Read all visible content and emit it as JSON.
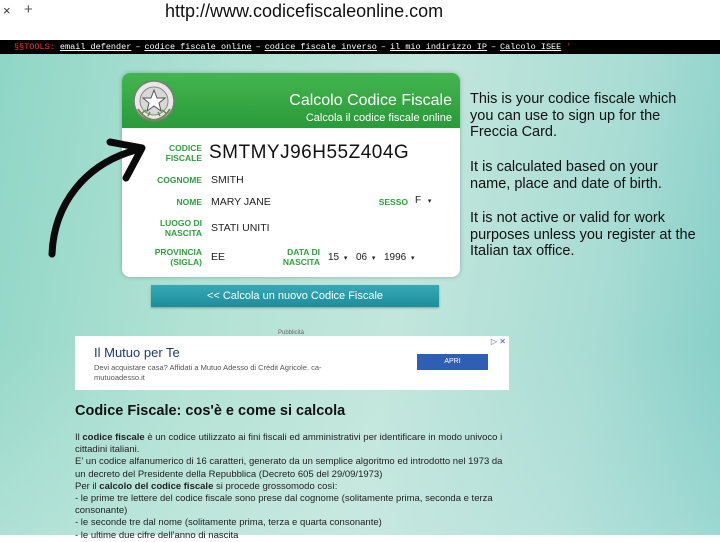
{
  "browser": {
    "close_glyph": "×",
    "new_tab_glyph": "+",
    "url": "http://www.codicefiscaleonline.com"
  },
  "toolbar": {
    "brand": "§§TOOLS:",
    "links": [
      "email defender",
      "codice fiscale online",
      "codice fiscale inverso",
      "il mio indirizzo IP",
      "Calcolo ISEE"
    ],
    "separator": "–",
    "end": "'"
  },
  "card": {
    "title": "Calcolo Codice Fiscale",
    "subtitle": "Calcola il codice fiscale online",
    "fields": {
      "codice_label": "CODICE FISCALE",
      "codice_value": "SMTMYJ96H55Z404G",
      "cognome_label": "COGNOME",
      "cognome_value": "SMITH",
      "nome_label": "NOME",
      "nome_value": "MARY JANE",
      "sesso_label": "SESSO",
      "sesso_value": "F",
      "luogo_label": "LUOGO DI NASCITA",
      "luogo_value": "STATI UNITI",
      "provincia_label": "PROVINCIA (SIGLA)",
      "provincia_value": "EE",
      "data_label": "DATA DI NASCITA",
      "day": "15",
      "month": "06",
      "year": "1996"
    },
    "dropdown_glyph": "▾"
  },
  "calc_button": "<< Calcola un nuovo Codice Fiscale",
  "caption": {
    "p1": "This is your codice fiscale which you can use to sign up for the Freccia Card.",
    "p2": "It is calculated based on your name, place and date of birth.",
    "p3": "It is not active or valid for work purposes unless you register at the Italian tax office."
  },
  "ad": {
    "label": "Pubblicità",
    "title": "Il Mutuo per Te",
    "text": "Devi acquistare casa? Affidati a Mutuo Adesso di Crédit Agricole. ca-mutuoadesso.it",
    "button": "APRI",
    "icons": "▷ ✕"
  },
  "article": {
    "title": "Codice Fiscale: cos'è e come si calcola",
    "p1_pre": "Il ",
    "p1_bold": "codice fiscale",
    "p1_post": " è un codice utilizzato ai fini fiscali ed amministrativi per identificare in modo univoco i cittadini italiani.",
    "p2": "E' un codice alfanumerico di 16 caratteri, generato da un semplice algoritmo ed introdotto nel 1973 da un decreto del Presidente della Repubblica (Decreto 605 del 29/09/1973)",
    "p3_pre": "Per il ",
    "p3_bold": "calcolo del codice fiscale",
    "p3_post": " si procede grossomodo così:",
    "items": [
      "- le prime tre lettere del codice fiscale sono prese dal cognome (solitamente prima, seconda e terza consonante)",
      "- le seconde tre dal nome (solitamente prima, terza e quarta consonante)",
      "- le ultime due cifre dell'anno di nascita"
    ]
  },
  "colors": {
    "header_green": "#2a9a3a",
    "label_green": "#2f9e3f",
    "button_teal": "#1e8d9b",
    "ad_blue": "#2f5fb3"
  }
}
